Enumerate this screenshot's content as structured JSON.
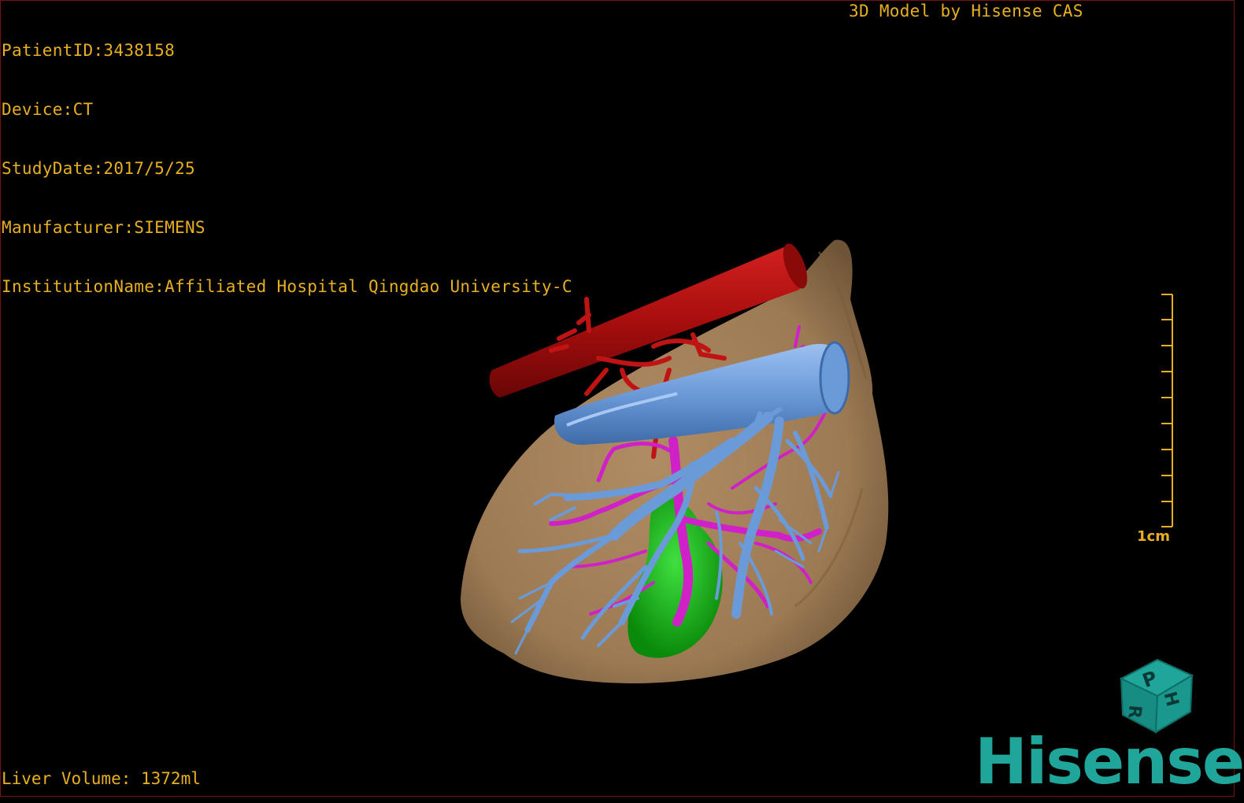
{
  "study_info": {
    "patient_id": "PatientID:3438158",
    "device": "Device:CT",
    "study_date": "StudyDate:2017/5/25",
    "manufacturer": "Manufacturer:SIEMENS",
    "institution": "InstitutionName:Affiliated Hospital Qingdao University-C"
  },
  "viewer_title": "3D Model by Hisense CAS",
  "liver_volume": "Liver Volume: 1372ml",
  "scale_bar": {
    "label": "1cm",
    "ticks": 10
  },
  "orientation_cube": {
    "faces": [
      "P",
      "R",
      "H"
    ]
  },
  "brand": "Hisense",
  "colors": {
    "text": "#e8b020",
    "liver": "#a07e58",
    "artery": "#b31212",
    "portal_vein": "#6b9ad8",
    "hepatic_vessel": "#d020c8",
    "gallbladder": "#16b416",
    "brand": "#1fa59a"
  },
  "icons": {
    "orientation_cube": "orientation-cube-icon",
    "scale_bar": "scale-bar-icon"
  }
}
